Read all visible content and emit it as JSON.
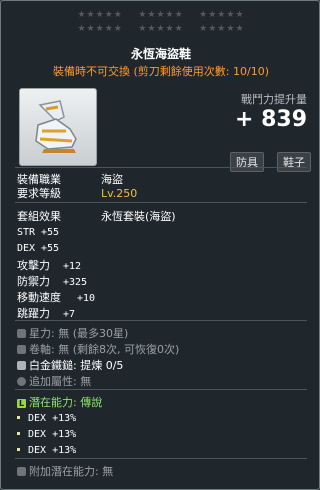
{
  "stars_row1": [
    "★★★★★",
    "★★★★★",
    "★★★★★"
  ],
  "stars_row2": [
    "★★★★★",
    "★★★★★",
    "★★★★★"
  ],
  "item": {
    "name": "永恆海盜鞋",
    "trade_note": "裝備時不可交換 (剪刀剩餘使用次數: 10/10)"
  },
  "combat_power": {
    "label": "戰鬥力提升量",
    "value": "+ 839"
  },
  "badges": [
    "防具",
    "鞋子"
  ],
  "requirements": {
    "job_label": "裝備職業",
    "job_value": "海盜",
    "level_label": "要求等級",
    "level_value": "Lv.250"
  },
  "set": {
    "label": "套組效果",
    "value": "永恆套裝(海盜)"
  },
  "stats": [
    {
      "name": "STR",
      "value": "+55"
    },
    {
      "name": "DEX",
      "value": "+55"
    },
    {
      "name": "攻擊力",
      "value": "+12"
    },
    {
      "name": "防禦力",
      "value": "+325"
    },
    {
      "name": "移動速度",
      "value": "+10"
    },
    {
      "name": "跳躍力",
      "value": "+7"
    }
  ],
  "extra": {
    "star_label": "星力",
    "star_value": ": 無 (最多30星)",
    "scroll_label": "卷軸",
    "scroll_value": ": 無 (剩餘8次, 可恢復0次)",
    "hammer_label": "白金鐵鎚",
    "hammer_value": ": 提煉 0/5",
    "add_label": "追加屬性",
    "add_value": ": 無"
  },
  "potential": {
    "label": "潛在能力",
    "grade": ": 傳說",
    "lines": [
      "DEX +13%",
      "DEX +13%",
      "DEX +13%"
    ]
  },
  "additional_potential": {
    "label": "附加潛在能力",
    "value": ": 無"
  },
  "colors": {
    "accent_orange": "#ff9a2e",
    "legend_green": "#8fe86b",
    "gold": "#e6c14a"
  }
}
